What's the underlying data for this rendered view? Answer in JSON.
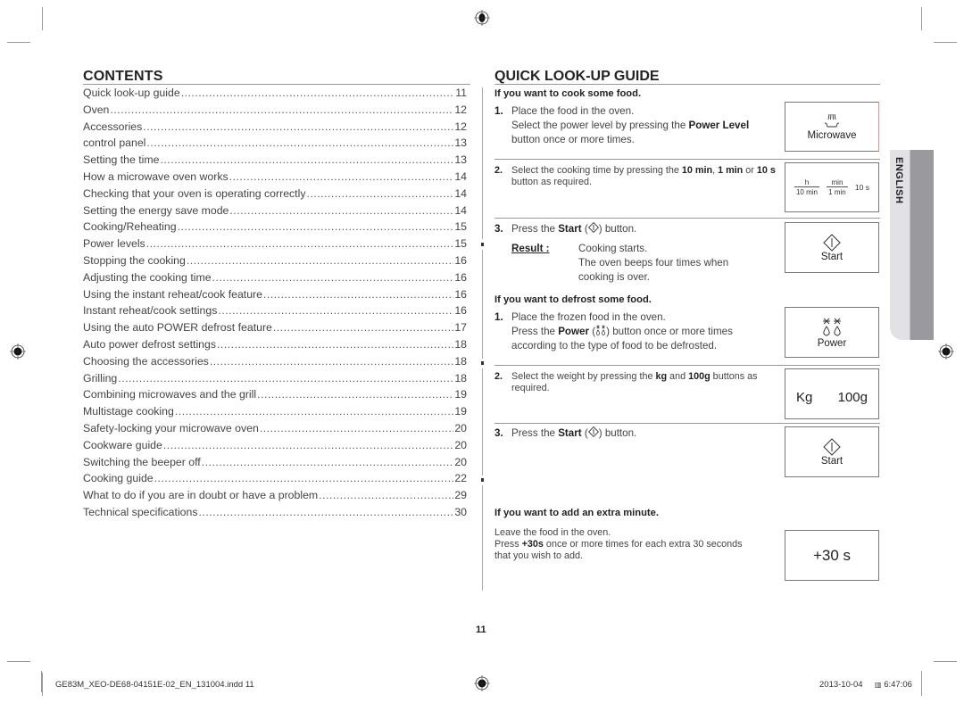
{
  "contents": {
    "title": "CONTENTS",
    "items": [
      {
        "label": "Quick look-up guide",
        "page": "11"
      },
      {
        "label": "Oven",
        "page": "12"
      },
      {
        "label": "Accessories",
        "page": "12"
      },
      {
        "label": "control panel",
        "page": "13"
      },
      {
        "label": "Setting the time",
        "page": "13"
      },
      {
        "label": "How a microwave oven works",
        "page": "14"
      },
      {
        "label": "Checking that your oven is operating correctly",
        "page": "14"
      },
      {
        "label": "Setting the energy save mode",
        "page": "14"
      },
      {
        "label": "Cooking/Reheating",
        "page": "15"
      },
      {
        "label": "Power levels",
        "page": "15"
      },
      {
        "label": "Stopping the cooking",
        "page": "16"
      },
      {
        "label": "Adjusting the cooking time",
        "page": "16"
      },
      {
        "label": "Using the instant reheat/cook feature",
        "page": "16"
      },
      {
        "label": "Instant reheat/cook settings",
        "page": "16"
      },
      {
        "label": "Using the auto POWER defrost feature",
        "page": "17"
      },
      {
        "label": "Auto power defrost settings",
        "page": "18"
      },
      {
        "label": "Choosing the accessories",
        "page": "18"
      },
      {
        "label": "Grilling",
        "page": "18"
      },
      {
        "label": "Combining microwaves and the grill",
        "page": "19"
      },
      {
        "label": "Multistage cooking",
        "page": "19"
      },
      {
        "label": "Safety-locking your microwave oven",
        "page": "20"
      },
      {
        "label": "Cookware guide",
        "page": "20"
      },
      {
        "label": "Switching the beeper off",
        "page": "20"
      },
      {
        "label": "Cooking guide",
        "page": "22"
      },
      {
        "label": "What to do if you are in doubt or have a problem",
        "page": "29"
      },
      {
        "label": "Technical specifications",
        "page": "30"
      }
    ]
  },
  "guide": {
    "title": "QUICK LOOK-UP GUIDE",
    "cook": {
      "heading": "If you want to cook some food.",
      "step1": {
        "num": "1.",
        "line1": "Place the food in the oven.",
        "pre": "Select the power level by pressing the ",
        "bold": "Power Level",
        "post": " button once or more times.",
        "panel_label": "Microwave"
      },
      "step2": {
        "num": "2.",
        "pre": "Select the cooking time by pressing the ",
        "b1": "10 min",
        "mid1": ", ",
        "b2": "1 min",
        "mid2": " or ",
        "b3": "10 s",
        "post": " button as required.",
        "panel": {
          "k1_top": "h",
          "k1_bottom": "10 min",
          "k2_top": "min",
          "k2_bottom": "1 min",
          "k3": "10 s"
        }
      },
      "step3": {
        "num": "3.",
        "pre": "Press the ",
        "bold": "Start",
        "post": " button.",
        "result_label": "Result :",
        "result_lines": [
          "Cooking starts.",
          "The oven beeps four times when",
          "cooking is over."
        ],
        "panel_label": "Start"
      }
    },
    "defrost": {
      "heading": "If you want to defrost some food.",
      "step1": {
        "num": "1.",
        "line1": "Place the frozen food in the oven.",
        "pre": "Press the ",
        "bold": "Power",
        "post": " button once or more times",
        "line3": "according to the type of food to be defrosted.",
        "panel_label": "Power"
      },
      "step2": {
        "num": "2.",
        "pre": "Select the weight by pressing the ",
        "b1": "kg",
        "mid": " and ",
        "b2": "100g",
        "post": " buttons as required.",
        "panel_kg": "Kg",
        "panel_100g": "100g"
      },
      "step3": {
        "num": "3.",
        "pre": "Press the ",
        "bold": "Start",
        "post": " button.",
        "panel_label": "Start"
      }
    },
    "extra": {
      "heading": "If you want to add an extra minute.",
      "line1": "Leave the food in the oven.",
      "pre": "Press ",
      "bold": "+30s",
      "post": " once or more times for each extra 30 seconds",
      "line3": "that you wish to add.",
      "panel_label": "+30 s"
    }
  },
  "language_tab": "ENGLISH",
  "page_number": "11",
  "slug": {
    "file": "GE83M_XEO-DE68-04151E-02_EN_131004.indd   11",
    "date": "2013-10-04",
    "time": "6:47:06"
  }
}
